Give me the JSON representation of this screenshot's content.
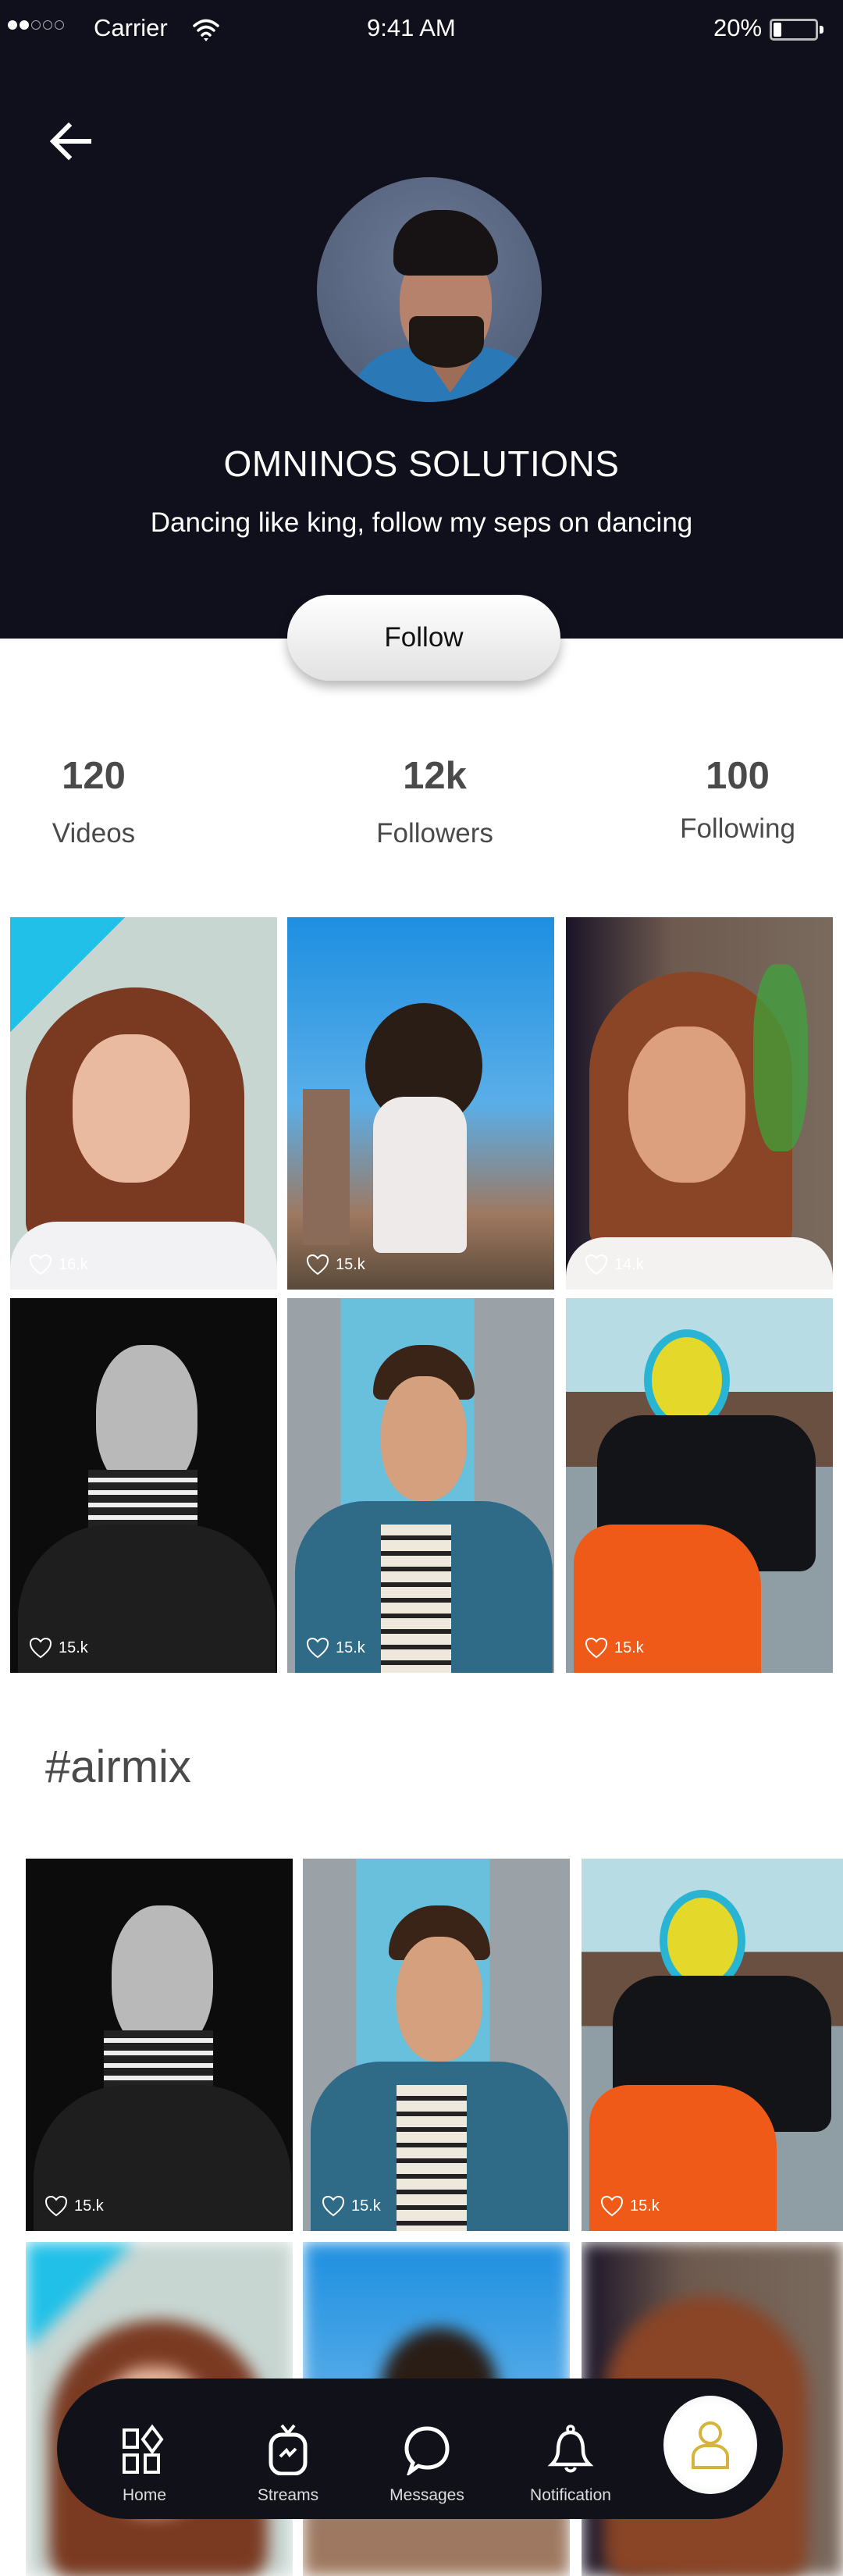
{
  "status_bar": {
    "signal_filled": 2,
    "signal_total": 5,
    "carrier": "Carrier",
    "time": "9:41 AM",
    "battery_percent": "20%",
    "battery_level": 0.2
  },
  "header": {
    "back_icon": "arrow-left-icon",
    "name": "OMNINOS SOLUTIONS",
    "bio": "Dancing like king, follow my seps on dancing",
    "follow_label": "Follow"
  },
  "stats": [
    {
      "value": "120",
      "label": "Videos"
    },
    {
      "value": "12k",
      "label": "Followers"
    },
    {
      "value": "100",
      "label": "Following"
    }
  ],
  "videos": [
    {
      "likes": "16.k",
      "subject": "red-haired woman, blue frame"
    },
    {
      "likes": "15.k",
      "subject": "curly-haired woman, city sky"
    },
    {
      "likes": "14.k",
      "subject": "smiling woman with flowers"
    },
    {
      "likes": "15.k",
      "subject": "man, black and white"
    },
    {
      "likes": "15.k",
      "subject": "man in denim jacket"
    },
    {
      "likes": "15.k",
      "subject": "motocross rider"
    }
  ],
  "hashtag_section": {
    "title": "#airmix",
    "videos": [
      {
        "likes": "15.k",
        "subject": "man, black and white"
      },
      {
        "likes": "15.k",
        "subject": "man in denim jacket"
      },
      {
        "likes": "15.k",
        "subject": "motocross rider"
      }
    ]
  },
  "bottom_nav": {
    "items": [
      {
        "label": "Home",
        "icon": "home-grid-icon"
      },
      {
        "label": "Streams",
        "icon": "tv-icon"
      },
      {
        "label": "Messages",
        "icon": "chat-bubble-icon"
      },
      {
        "label": "Notification",
        "icon": "bell-icon"
      }
    ],
    "active": {
      "icon": "profile-icon",
      "color": "#d4b43c"
    }
  },
  "colors": {
    "header_bg": "#10101c",
    "text_dark": "#4a4a4a",
    "accent": "#d4b43c"
  }
}
